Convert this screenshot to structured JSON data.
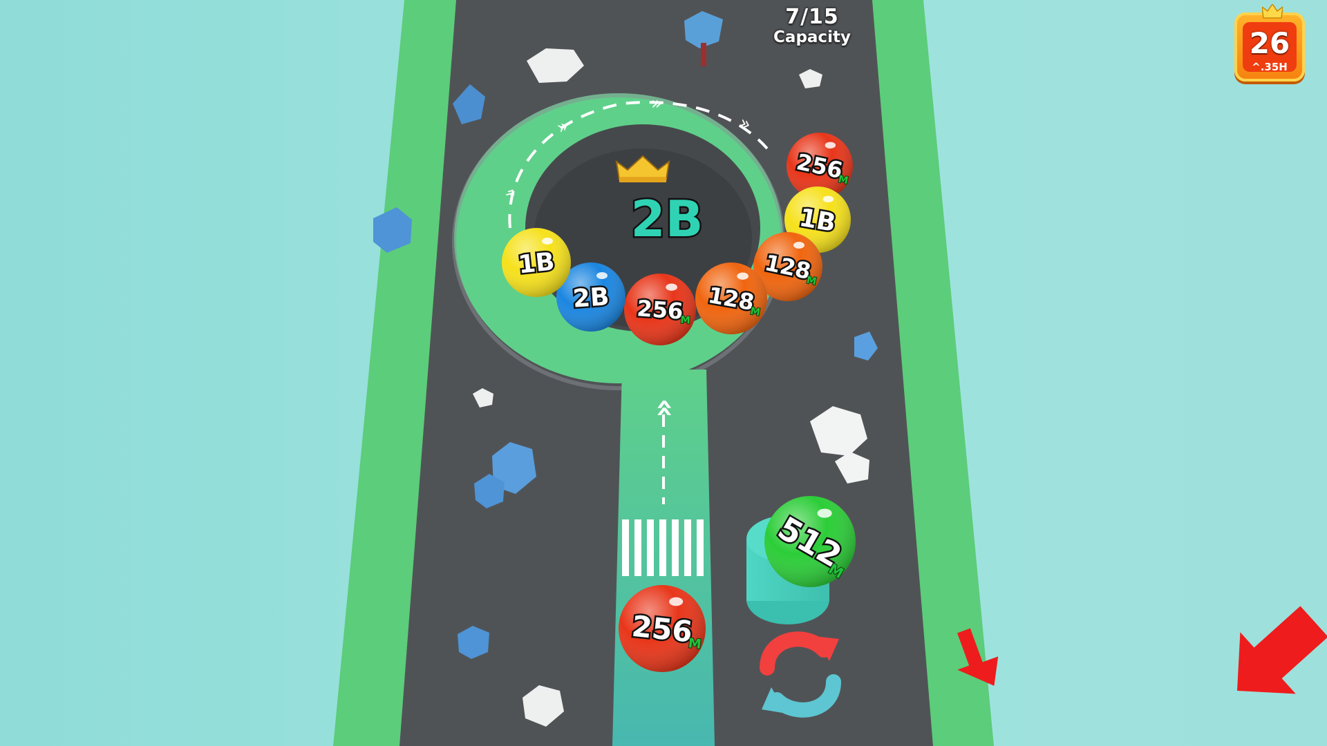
{
  "hud": {
    "capacity_count": "7/15",
    "capacity_label": "Capacity",
    "level_number": "26",
    "level_sub": "^.35H"
  },
  "ring": {
    "center_value": "2B",
    "balls": [
      {
        "label": "256",
        "suffix": "M",
        "color": "#e8361a"
      },
      {
        "label": "1B",
        "suffix": "",
        "color": "#f6e11c"
      },
      {
        "label": "128",
        "suffix": "M",
        "color": "#f0650f"
      },
      {
        "label": "128",
        "suffix": "M",
        "color": "#f0650f"
      },
      {
        "label": "256",
        "suffix": "M",
        "color": "#e8361a"
      },
      {
        "label": "2B",
        "suffix": "",
        "color": "#1b86e0"
      },
      {
        "label": "1B",
        "suffix": "",
        "color": "#f6e11c"
      }
    ]
  },
  "launcher": {
    "ball_label": "256",
    "ball_suffix": "M",
    "ball_color": "#e8361a"
  },
  "next_ball": {
    "label": "512",
    "suffix": "M",
    "color": "#2ccd38"
  },
  "colors": {
    "sky": "#9ee1dd",
    "road": "#505356",
    "grass": "#5ccd7a",
    "track": "#5fd08a",
    "arrow_red": "#ee1c1c",
    "swap_red": "#f2403e",
    "swap_teal": "#5dc6d2"
  },
  "icons": {
    "crown": "crown-icon",
    "swap": "swap-icon",
    "tutorial_arrow": "pointer-arrow-icon"
  }
}
